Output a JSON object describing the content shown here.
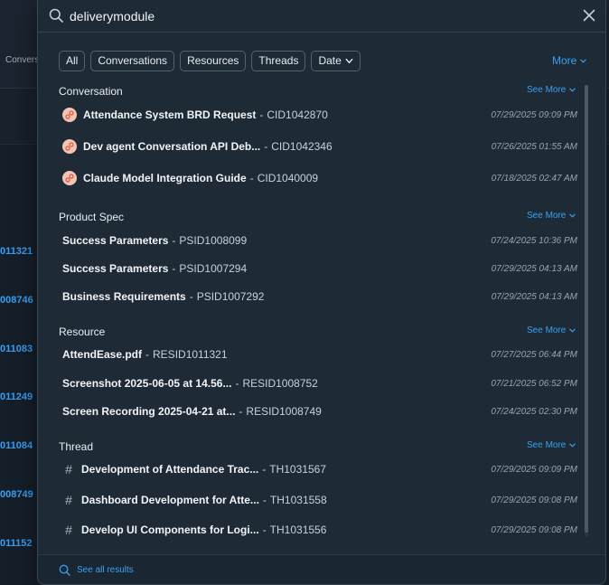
{
  "background": {
    "tab_label": "Convers",
    "ids": [
      "011321",
      "008746",
      "011083",
      "011249",
      "011084",
      "008749",
      "011152"
    ]
  },
  "search": {
    "value": "deliverymodule",
    "placeholder": ""
  },
  "filters": {
    "chips": [
      "All",
      "Conversations",
      "Resources",
      "Threads",
      "Date"
    ],
    "more_label": "More"
  },
  "sections": {
    "conversation": {
      "title": "Conversation",
      "see_more": "See More",
      "items": [
        {
          "title": "Attendance System BRD Request",
          "id": "CID1042870",
          "time": "07/29/2025 09:09 PM"
        },
        {
          "title": "Dev agent Conversation API Deb...",
          "id": "CID1042346",
          "time": "07/26/2025 01:55 AM"
        },
        {
          "title": "Claude Model Integration Guide",
          "id": "CID1040009",
          "time": "07/18/2025 02:47 AM"
        }
      ]
    },
    "product_spec": {
      "title": "Product Spec",
      "see_more": "See More",
      "items": [
        {
          "title": "Success Parameters",
          "id": "PSID1008099",
          "time": "07/24/2025 10:36 PM"
        },
        {
          "title": "Success Parameters",
          "id": "PSID1007294",
          "time": "07/29/2025 04:13 AM"
        },
        {
          "title": "Business Requirements",
          "id": "PSID1007292",
          "time": "07/29/2025 04:13 AM"
        }
      ]
    },
    "resource": {
      "title": "Resource",
      "see_more": "See More",
      "items": [
        {
          "title": "AttendEase.pdf",
          "id": "RESID1011321",
          "time": "07/27/2025 06:44 PM"
        },
        {
          "title": "Screenshot 2025-06-05 at 14.56...",
          "id": "RESID1008752",
          "time": "07/21/2025 06:52 PM"
        },
        {
          "title": "Screen Recording 2025-04-21 at...",
          "id": "RESID1008749",
          "time": "07/24/2025 02:30 PM"
        }
      ]
    },
    "thread": {
      "title": "Thread",
      "see_more": "See More",
      "items": [
        {
          "title": "Development of Attendance Trac...",
          "id": "TH1031567",
          "time": "07/29/2025 09:09 PM"
        },
        {
          "title": "Dashboard Development for Atte...",
          "id": "TH1031558",
          "time": "07/29/2025 09:08 PM"
        },
        {
          "title": "Develop UI Components for Logi...",
          "id": "TH1031556",
          "time": "07/29/2025 09:08 PM"
        }
      ]
    }
  },
  "footer": {
    "see_all_label": "See all results"
  },
  "sep": "-",
  "colors": {
    "accent": "#36a3f2",
    "panel": "#1f2a37",
    "conversation_icon_bg": "#f3c4b5",
    "conversation_icon_fg": "#d9573a"
  }
}
